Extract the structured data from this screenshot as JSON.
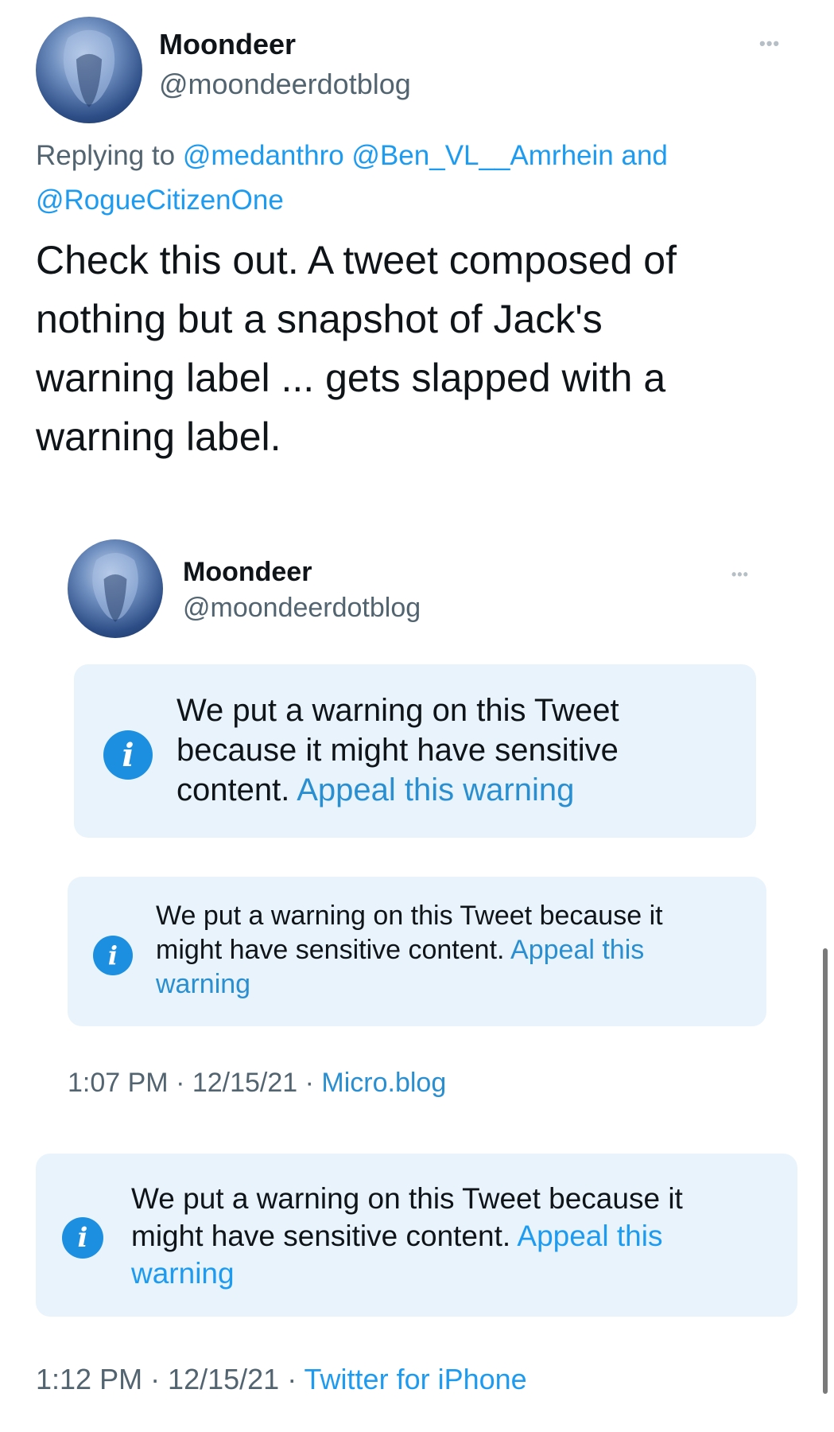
{
  "tweet": {
    "author_name": "Moondeer",
    "author_handle": "@moondeerdotblog",
    "more_label": "•••",
    "replying_prefix": "Replying to ",
    "replying_users": [
      "@medanthro",
      "@Ben_VL__Amrhein",
      "@RogueCitizenOne"
    ],
    "replying_and": "and",
    "body_lines": [
      "Check this out. A tweet composed of",
      "nothing but a snapshot of Jack's",
      "warning label ... gets slapped with a",
      "warning label."
    ]
  },
  "embedded": {
    "author_name": "Moondeer",
    "author_handle": "@moondeerdotblog",
    "more_label": "•••",
    "warning_large": {
      "lines": [
        "We put a warning on this Tweet",
        "because it might have sensitive",
        "content. "
      ],
      "appeal": "Appeal this warning"
    },
    "warning_inner": {
      "lines": [
        "We put a warning on this Tweet because it",
        "might have sensitive content. "
      ],
      "appeal_a": "Appeal this",
      "appeal_b": "warning"
    },
    "timestamp": "1:07 PM · 12/15/21 · ",
    "source": "Micro.blog"
  },
  "outer_warning": {
    "lines": [
      "We put a warning on this Tweet because it",
      "might have sensitive content. "
    ],
    "appeal_a": "Appeal this",
    "appeal_b": "warning"
  },
  "footer": {
    "timestamp": "1:12 PM · 12/15/21 · ",
    "source": "Twitter for iPhone"
  },
  "icons": {
    "info": "i"
  },
  "colors": {
    "link": "#1d9bf0",
    "card_bg": "#e8f3fc",
    "info_icon": "#1d8fe0"
  }
}
